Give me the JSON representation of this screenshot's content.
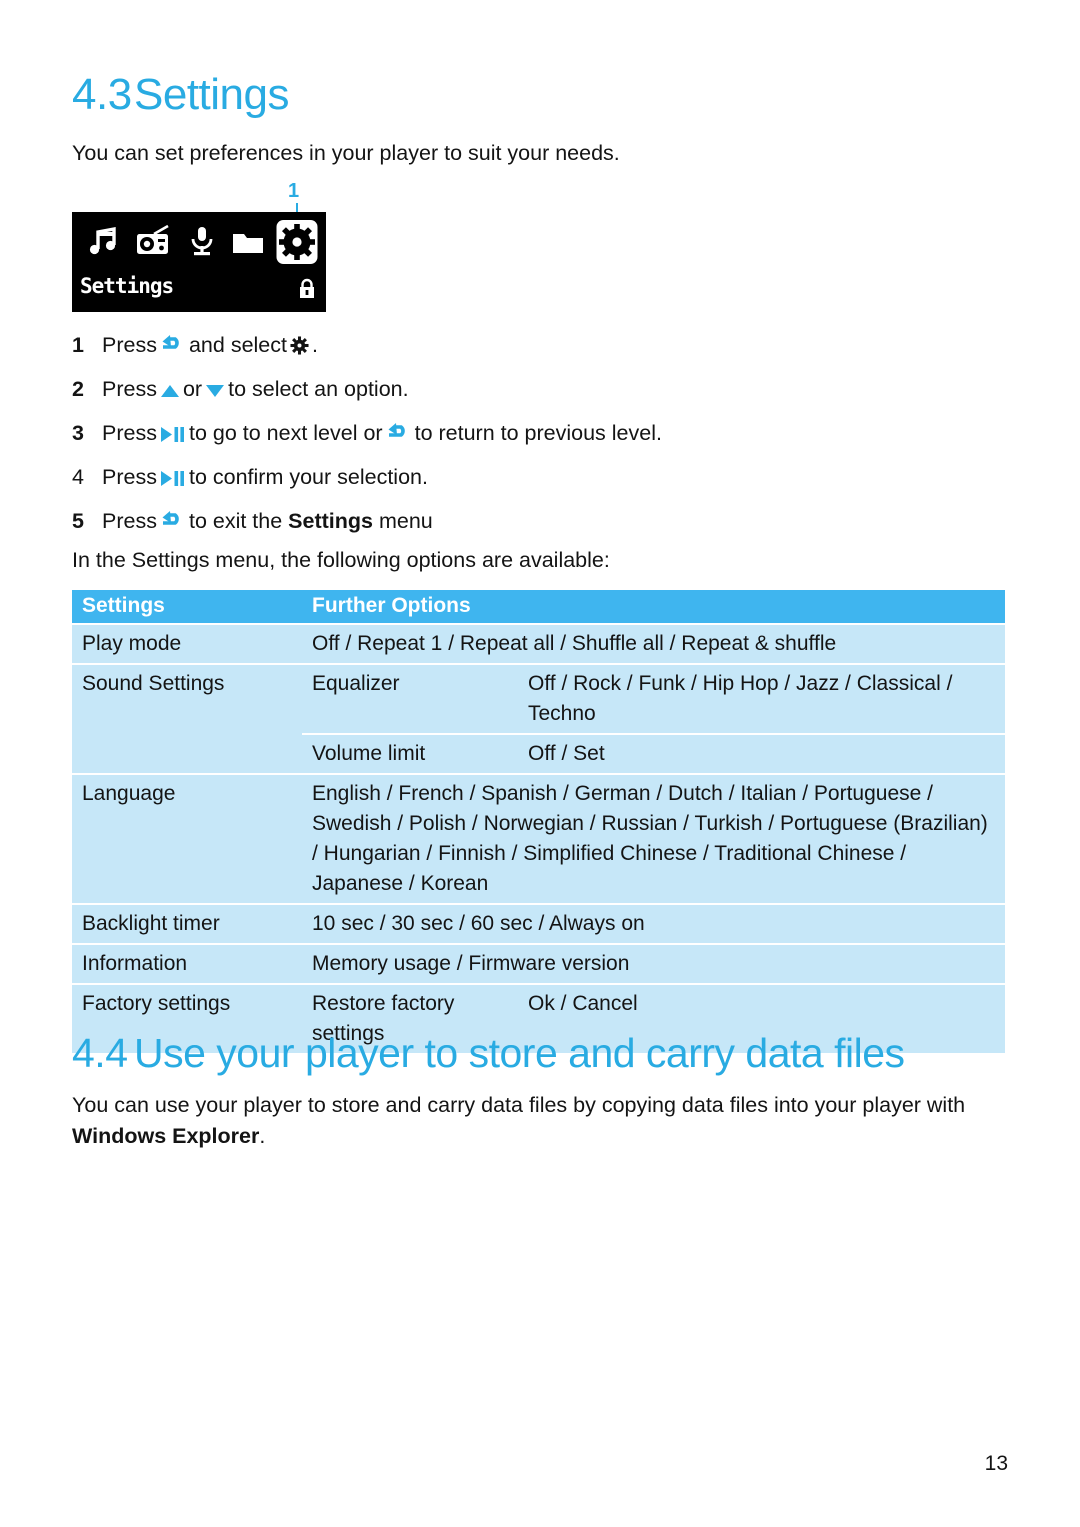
{
  "colors": {
    "accent_blue": "#29ABE2",
    "table_header_blue": "#3FB5EF",
    "table_row_blue": "#C6E7F8",
    "text_black": "#141414",
    "lcd_background": "#000000"
  },
  "section_43": {
    "number": "4.3",
    "title": "Settings",
    "intro": "You can set preferences in your player to suit your needs."
  },
  "device_screen": {
    "callout_label": "1",
    "menu_label": "Settings",
    "icons": [
      {
        "name": "music-icon",
        "selected": false
      },
      {
        "name": "radio-icon",
        "selected": false
      },
      {
        "name": "microphone-icon",
        "selected": false
      },
      {
        "name": "folder-icon",
        "selected": false
      },
      {
        "name": "gear-icon",
        "selected": true
      }
    ],
    "status_icon": "lock-icon"
  },
  "steps": [
    {
      "number": "1",
      "bold_number": true,
      "parts": [
        {
          "type": "text",
          "value": "Press "
        },
        {
          "type": "icon",
          "value": "back-arrow-icon"
        },
        {
          "type": "text",
          "value": " and select "
        },
        {
          "type": "icon",
          "value": "gear-icon"
        },
        {
          "type": "text",
          "value": "."
        }
      ],
      "plain": "Press (back) and select (settings)."
    },
    {
      "number": "2",
      "bold_number": true,
      "parts": [
        {
          "type": "text",
          "value": "Press "
        },
        {
          "type": "icon",
          "value": "up-triangle-icon"
        },
        {
          "type": "text",
          "value": " or "
        },
        {
          "type": "icon",
          "value": "down-triangle-icon"
        },
        {
          "type": "text",
          "value": " to select an option."
        }
      ],
      "plain": "Press (up) or (down) to select an option."
    },
    {
      "number": "3",
      "bold_number": true,
      "parts": [
        {
          "type": "text",
          "value": "Press "
        },
        {
          "type": "icon",
          "value": "play-pause-icon"
        },
        {
          "type": "text",
          "value": " to go to next level or "
        },
        {
          "type": "icon",
          "value": "back-arrow-icon"
        },
        {
          "type": "text",
          "value": " to return to previous level."
        }
      ],
      "plain": "Press (play/pause) to go to next level or (back) to return to previous level."
    },
    {
      "number": "4",
      "bold_number": false,
      "parts": [
        {
          "type": "text",
          "value": "Press "
        },
        {
          "type": "icon",
          "value": "play-pause-icon"
        },
        {
          "type": "text",
          "value": " to confirm your selection."
        }
      ],
      "plain": "Press (play/pause) to confirm your selection."
    },
    {
      "number": "5",
      "bold_number": true,
      "parts": [
        {
          "type": "text",
          "value": "Press "
        },
        {
          "type": "icon",
          "value": "back-arrow-icon"
        },
        {
          "type": "text",
          "value": " to exit the "
        },
        {
          "type": "bold",
          "value": "Settings"
        },
        {
          "type": "text",
          "value": " menu"
        }
      ],
      "plain": "Press (back) to exit the Settings menu"
    }
  ],
  "table_intro": "In the Settings menu, the following options are available:",
  "table": {
    "headers": [
      "Settings",
      "Further Options"
    ],
    "rows": [
      {
        "setting": "Play mode",
        "options": "Off / Repeat 1 / Repeat all / Shuffle all / Repeat & shuffle"
      },
      {
        "setting": "Sound Settings",
        "subrows": [
          {
            "option": "Equalizer",
            "values": "Off / Rock / Funk / Hip Hop / Jazz / Classical / Techno"
          },
          {
            "option": "Volume limit",
            "values": "Off / Set"
          }
        ]
      },
      {
        "setting": "Language",
        "options": "English / French / Spanish / German / Dutch / Italian / Portuguese / Swedish / Polish / Norwegian / Russian / Turkish / Portuguese (Brazilian) / Hungarian / Finnish / Simplified Chinese / Traditional Chinese / Japanese / Korean"
      },
      {
        "setting": "Backlight timer",
        "options": "10 sec / 30 sec / 60 sec / Always on"
      },
      {
        "setting": "Information",
        "options": "Memory usage / Firmware version"
      },
      {
        "setting": "Factory settings",
        "subrows": [
          {
            "option": "Restore factory settings",
            "values": "Ok / Cancel"
          }
        ]
      }
    ]
  },
  "section_44": {
    "number": "4.4",
    "title": "Use your player to store and carry data files",
    "body_before": "You can use your player to store and carry data files by copying data files into your player with ",
    "body_bold": "Windows Explorer",
    "body_after": "."
  },
  "page_number": "13"
}
